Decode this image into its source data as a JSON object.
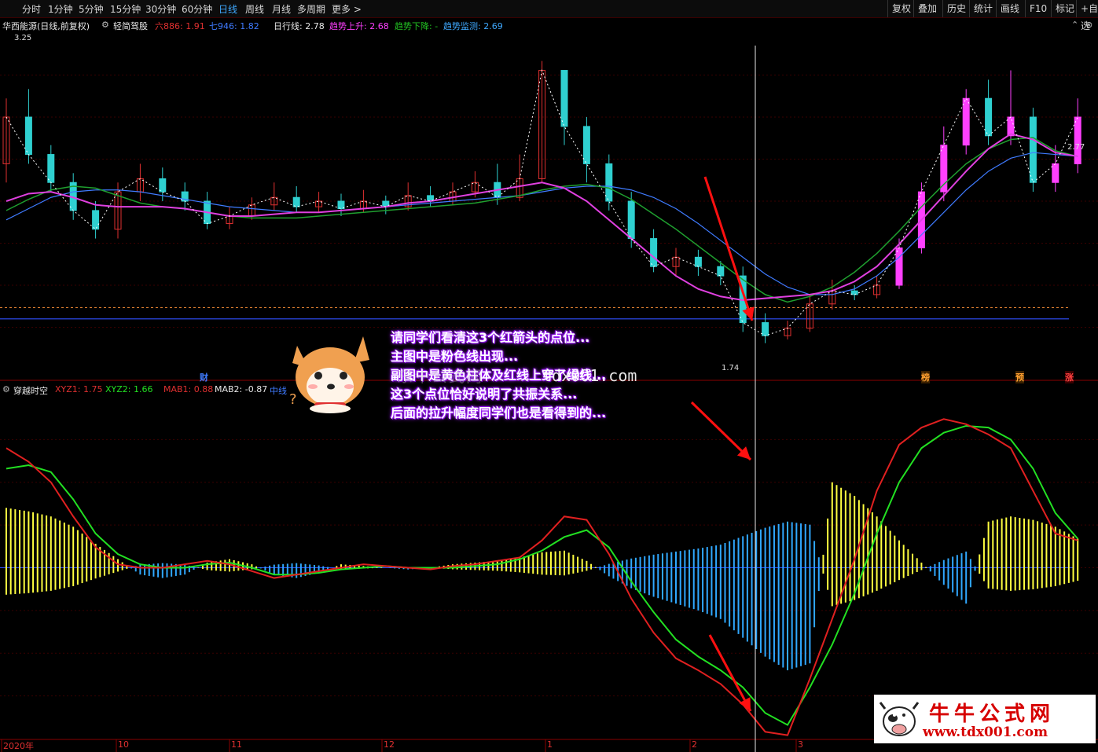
{
  "toolbar": {
    "periods": [
      "分时",
      "1分钟",
      "5分钟",
      "15分钟",
      "30分钟",
      "60分钟",
      "日线",
      "周线",
      "月线",
      "多周期",
      "更多 >"
    ],
    "active_period": "日线",
    "right_buttons": [
      "复权",
      "叠加",
      "历史",
      "统计",
      "画线",
      "F10",
      "标记",
      "+自选"
    ]
  },
  "main_info": {
    "stock": "华西能源(日线,前复权)",
    "indicator": "轻简驾股",
    "items": [
      {
        "label": "六886:",
        "value": "1.91",
        "color": "#e03030"
      },
      {
        "label": "七946:",
        "value": "1.82",
        "color": "#3f7bff"
      },
      {
        "label": "日行线:",
        "value": "2.78",
        "color": "#e8e8e8"
      },
      {
        "label": "趋势上升:",
        "value": "2.68",
        "color": "#ff40ff"
      },
      {
        "label": "趋势下降:",
        "value": "-",
        "color": "#22c022"
      },
      {
        "label": "趋势监测:",
        "value": "2.69",
        "color": "#3fa9ff"
      }
    ],
    "high_label": "3.25",
    "low_label": "1.74",
    "last_label": "2.77"
  },
  "sub_info": {
    "indicator": "穿越时空",
    "items": [
      {
        "label": "XYZ1:",
        "value": "1.75",
        "color": "#e03030"
      },
      {
        "label": "XYZ2:",
        "value": "1.66",
        "color": "#22e022"
      },
      {
        "label": "MAB1:",
        "value": "0.88",
        "color": "#e03030"
      },
      {
        "label": "MAB2:",
        "value": "-0.87",
        "color": "#e8e8e8"
      },
      {
        "label": "中线",
        "value": "",
        "color": "#3f7bff"
      }
    ]
  },
  "markers": {
    "cai": "财",
    "bang": "榜",
    "yu": "预",
    "zhang": "涨"
  },
  "annotation": [
    "请同学们看清这3个红箭头的点位...",
    "主图中是粉色线出现...",
    "副图中是黄色柱体及红线上穿了绿线...",
    "这3个点位恰好说明了共振关系...",
    "后面的拉升幅度同学们也是看得到的..."
  ],
  "faint_text": "东牛公式网",
  "faint_text2": "tdx001.com",
  "watermark": {
    "title": "牛牛公式网",
    "url": "www.tdx001.com"
  },
  "x_axis": [
    "2020年",
    "10",
    "11",
    "12",
    "1",
    "2",
    "3"
  ],
  "chart_data": [
    {
      "type": "candlestick",
      "name": "main",
      "ylim": [
        1.6,
        3.4
      ],
      "ref_levels": [
        1.93,
        1.87
      ],
      "high": 3.25,
      "low": 1.74,
      "lines": {
        "ma1": {
          "color": "#3f7bff",
          "values": [
            2.4,
            2.46,
            2.52,
            2.55,
            2.56,
            2.56,
            2.55,
            2.53,
            2.51,
            2.49,
            2.47,
            2.46,
            2.45,
            2.44,
            2.44,
            2.45,
            2.46,
            2.47,
            2.48,
            2.49,
            2.5,
            2.51,
            2.52,
            2.53,
            2.55,
            2.57,
            2.58,
            2.58,
            2.56,
            2.52,
            2.46,
            2.38,
            2.29,
            2.2,
            2.11,
            2.04,
            2.0,
            2.0,
            2.03,
            2.1,
            2.2,
            2.32,
            2.44,
            2.56,
            2.66,
            2.73,
            2.76,
            2.75,
            2.74
          ]
        },
        "ma2": {
          "color": "#1f9f2f",
          "values": [
            2.45,
            2.51,
            2.56,
            2.58,
            2.57,
            2.53,
            2.49,
            2.47,
            2.46,
            2.44,
            2.42,
            2.41,
            2.41,
            2.41,
            2.42,
            2.43,
            2.44,
            2.45,
            2.46,
            2.47,
            2.48,
            2.49,
            2.51,
            2.53,
            2.56,
            2.58,
            2.59,
            2.57,
            2.51,
            2.43,
            2.35,
            2.26,
            2.17,
            2.08,
            2.0,
            1.96,
            1.99,
            2.04,
            2.12,
            2.22,
            2.34,
            2.47,
            2.59,
            2.7,
            2.78,
            2.83,
            2.84,
            2.77,
            2.74
          ]
        },
        "ma3": {
          "color": "#e040e0",
          "values": [
            2.5,
            2.54,
            2.55,
            2.52,
            2.48,
            2.47,
            2.47,
            2.47,
            2.46,
            2.44,
            2.42,
            2.42,
            2.43,
            2.44,
            2.44,
            2.45,
            2.46,
            2.47,
            2.49,
            2.5,
            2.52,
            2.54,
            2.56,
            2.58,
            2.6,
            2.57,
            2.5,
            2.4,
            2.3,
            2.2,
            2.1,
            2.03,
            1.99,
            1.97,
            1.98,
            1.99,
            2.0,
            2.02,
            2.07,
            2.15,
            2.27,
            2.4,
            2.53,
            2.66,
            2.78,
            2.86,
            2.83,
            2.76,
            2.74
          ]
        }
      },
      "candles": [
        [
          2.7,
          2.95,
          3.05,
          2.6
        ],
        [
          2.95,
          2.75,
          3.1,
          2.7
        ],
        [
          2.75,
          2.6,
          2.8,
          2.55
        ],
        [
          2.6,
          2.45,
          2.65,
          2.4
        ],
        [
          2.45,
          2.35,
          2.5,
          2.3
        ],
        [
          2.35,
          2.55,
          2.6,
          2.3
        ],
        [
          2.55,
          2.62,
          2.7,
          2.5
        ],
        [
          2.62,
          2.55,
          2.68,
          2.5
        ],
        [
          2.55,
          2.5,
          2.6,
          2.45
        ],
        [
          2.5,
          2.38,
          2.55,
          2.35
        ],
        [
          2.38,
          2.42,
          2.47,
          2.35
        ],
        [
          2.42,
          2.48,
          2.52,
          2.4
        ],
        [
          2.48,
          2.52,
          2.6,
          2.45
        ],
        [
          2.52,
          2.47,
          2.58,
          2.44
        ],
        [
          2.47,
          2.5,
          2.55,
          2.44
        ],
        [
          2.5,
          2.46,
          2.54,
          2.42
        ],
        [
          2.46,
          2.5,
          2.56,
          2.44
        ],
        [
          2.5,
          2.47,
          2.53,
          2.43
        ],
        [
          2.47,
          2.53,
          2.6,
          2.45
        ],
        [
          2.53,
          2.5,
          2.58,
          2.47
        ],
        [
          2.5,
          2.55,
          2.6,
          2.48
        ],
        [
          2.55,
          2.6,
          2.66,
          2.52
        ],
        [
          2.6,
          2.52,
          2.7,
          2.48
        ],
        [
          2.52,
          2.62,
          2.75,
          2.5
        ],
        [
          2.62,
          3.2,
          3.25,
          2.6
        ],
        [
          3.2,
          2.9,
          3.0,
          2.8
        ],
        [
          2.9,
          2.7,
          2.95,
          2.6
        ],
        [
          2.7,
          2.5,
          2.75,
          2.45
        ],
        [
          2.5,
          2.3,
          2.55,
          2.25
        ],
        [
          2.3,
          2.15,
          2.35,
          2.12
        ],
        [
          2.15,
          2.2,
          2.25,
          2.1
        ],
        [
          2.2,
          2.15,
          2.24,
          2.1
        ],
        [
          2.15,
          2.1,
          2.18,
          2.05
        ],
        [
          2.1,
          1.85,
          2.15,
          1.8
        ],
        [
          1.85,
          1.78,
          1.9,
          1.74
        ],
        [
          1.78,
          1.82,
          1.86,
          1.76
        ],
        [
          1.82,
          1.95,
          2.0,
          1.8
        ],
        [
          1.95,
          2.02,
          2.08,
          1.92
        ],
        [
          2.02,
          2.0,
          2.05,
          1.97
        ],
        [
          2.0,
          2.05,
          2.1,
          1.98
        ],
        [
          2.05,
          2.25,
          2.3,
          2.03
        ],
        [
          2.25,
          2.55,
          2.6,
          2.22
        ],
        [
          2.55,
          2.8,
          2.9,
          2.5
        ],
        [
          2.8,
          3.05,
          3.1,
          2.75
        ],
        [
          3.05,
          2.85,
          3.15,
          2.8
        ],
        [
          2.85,
          2.95,
          3.2,
          2.8
        ],
        [
          2.95,
          2.6,
          3.0,
          2.55
        ],
        [
          2.6,
          2.7,
          2.8,
          2.55
        ],
        [
          2.7,
          2.95,
          3.05,
          2.65
        ]
      ]
    },
    {
      "type": "histogram+lines",
      "name": "sub",
      "ylim": [
        -1.0,
        1.0
      ],
      "bars": [
        0.35,
        0.33,
        0.3,
        0.24,
        0.14,
        0.05,
        -0.04,
        -0.06,
        -0.04,
        0.03,
        0.05,
        0.02,
        -0.04,
        -0.06,
        -0.03,
        0.02,
        0.01,
        0.0,
        -0.01,
        0.0,
        0.02,
        0.03,
        0.04,
        0.06,
        0.09,
        0.1,
        0.04,
        -0.05,
        -0.12,
        -0.17,
        -0.21,
        -0.25,
        -0.3,
        -0.41,
        -0.52,
        -0.6,
        -0.56,
        0.5,
        0.42,
        0.3,
        0.16,
        0.03,
        -0.1,
        -0.21,
        0.27,
        0.3,
        0.28,
        0.24,
        0.17
      ],
      "xyz1": [
        0.7,
        0.62,
        0.5,
        0.3,
        0.12,
        0.02,
        0.0,
        0.0,
        0.02,
        0.04,
        0.02,
        -0.02,
        -0.06,
        -0.04,
        -0.02,
        0.0,
        0.02,
        0.01,
        0.0,
        -0.01,
        0.01,
        0.02,
        0.04,
        0.06,
        0.16,
        0.3,
        0.28,
        0.08,
        -0.18,
        -0.38,
        -0.53,
        -0.6,
        -0.68,
        -0.8,
        -0.96,
        -0.98,
        -0.65,
        -0.3,
        0.05,
        0.45,
        0.72,
        0.82,
        0.87,
        0.84,
        0.78,
        0.7,
        0.45,
        0.2,
        0.16
      ],
      "xyz2": [
        0.58,
        0.6,
        0.56,
        0.4,
        0.2,
        0.08,
        0.02,
        0.0,
        0.0,
        0.02,
        0.03,
        0.0,
        -0.04,
        -0.04,
        -0.03,
        -0.01,
        0.0,
        0.01,
        0.0,
        0.0,
        0.0,
        0.01,
        0.02,
        0.05,
        0.1,
        0.18,
        0.22,
        0.12,
        -0.08,
        -0.26,
        -0.42,
        -0.52,
        -0.6,
        -0.7,
        -0.85,
        -0.92,
        -0.7,
        -0.45,
        -0.15,
        0.2,
        0.5,
        0.7,
        0.79,
        0.83,
        0.82,
        0.75,
        0.58,
        0.32,
        0.17
      ]
    }
  ]
}
